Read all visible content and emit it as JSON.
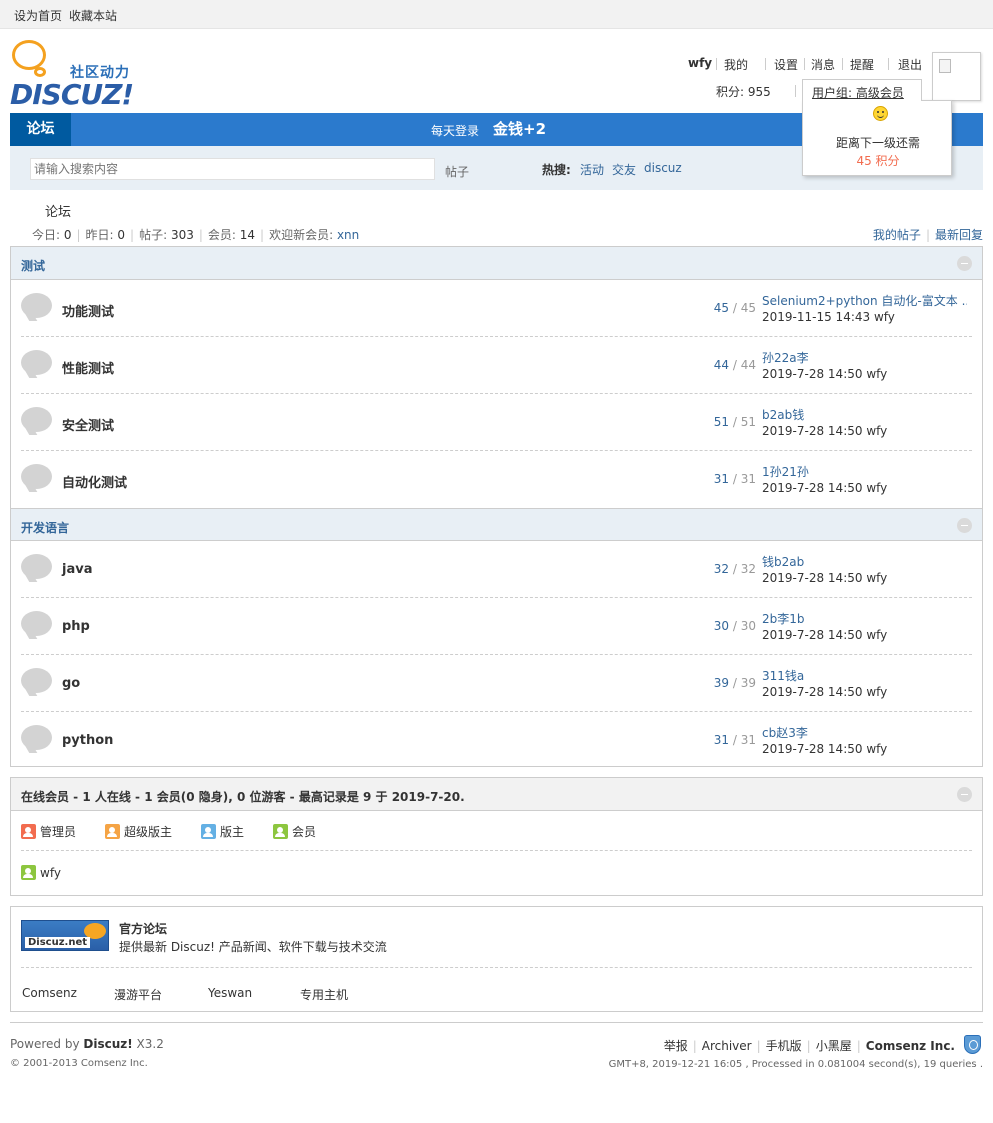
{
  "topbar": {
    "set_home": "设为首页",
    "bookmark": "收藏本站"
  },
  "logo": {
    "sub": "社区动力",
    "main": "DISCUZ!"
  },
  "user_menu": {
    "username": "wfy",
    "mine": "我的",
    "settings": "设置",
    "messages": "消息",
    "reminders": "提醒",
    "logout": "退出",
    "credits": "积分: 955",
    "usergroup": "用户组: 高级会员"
  },
  "popup": {
    "line1": "距离下一级还需",
    "line2": "45 积分"
  },
  "nav": {
    "forum": "论坛",
    "daily_login": "每天登录",
    "money": "金钱+2"
  },
  "search": {
    "placeholder": "请输入搜索内容",
    "type": "帖子",
    "hot_label": "热搜:",
    "hot_terms": [
      "活动",
      "交友",
      "discuz"
    ]
  },
  "breadcrumb": "论坛",
  "stats": {
    "today_label": "今日: ",
    "today": "0",
    "yesterday_label": "昨日: ",
    "yesterday": "0",
    "posts_label": "帖子: ",
    "posts": "303",
    "members_label": "会员: ",
    "members": "14",
    "welcome_label": "欢迎新会员: ",
    "new_member": "xnn"
  },
  "my_links": {
    "my_posts": "我的帖子",
    "latest": "最新回复"
  },
  "categories": [
    {
      "title": "测试",
      "forums": [
        {
          "name": "功能测试",
          "threads": "45",
          "posts": "45",
          "last_title": "Selenium2+python 自动化-富文本 ...",
          "last_meta": "2019-11-15 14:43 wfy"
        },
        {
          "name": "性能测试",
          "threads": "44",
          "posts": "44",
          "last_title": "孙22a李",
          "last_meta": "2019-7-28 14:50 wfy"
        },
        {
          "name": "安全测试",
          "threads": "51",
          "posts": "51",
          "last_title": "b2ab钱",
          "last_meta": "2019-7-28 14:50 wfy"
        },
        {
          "name": "自动化测试",
          "threads": "31",
          "posts": "31",
          "last_title": "1孙21孙",
          "last_meta": "2019-7-28 14:50 wfy"
        }
      ]
    },
    {
      "title": "开发语言",
      "forums": [
        {
          "name": "java",
          "threads": "32",
          "posts": "32",
          "last_title": "钱b2ab",
          "last_meta": "2019-7-28 14:50 wfy"
        },
        {
          "name": "php",
          "threads": "30",
          "posts": "30",
          "last_title": "2b李1b",
          "last_meta": "2019-7-28 14:50 wfy"
        },
        {
          "name": "go",
          "threads": "39",
          "posts": "39",
          "last_title": "311钱a",
          "last_meta": "2019-7-28 14:50 wfy"
        },
        {
          "name": "python",
          "threads": "31",
          "posts": "31",
          "last_title": "cb赵3李",
          "last_meta": "2019-7-28 14:50 wfy"
        }
      ]
    }
  ],
  "online": {
    "title": "在线会员 - 1 人在线 - 1 会员(0 隐身), 0 位游客 - 最高记录是 9 于 2019-7-20.",
    "legend": [
      "管理员",
      "超级版主",
      "版主",
      "会员"
    ],
    "users": [
      "wfy"
    ],
    "colors": {
      "admin": "#f26c4f",
      "super_mod": "#f5a445",
      "mod": "#64b0e4",
      "member": "#8dc63f"
    }
  },
  "links": {
    "logo_text": "Discuz.net",
    "title": "官方论坛",
    "desc": "提供最新 Discuz! 产品新闻、软件下载与技术交流",
    "items": [
      "Comsenz",
      "漫游平台",
      "Yeswan",
      "专用主机"
    ]
  },
  "footer": {
    "powered_by": "Powered by ",
    "product": "Discuz!",
    "version": " X3.2",
    "copyright": "© 2001-2013 Comsenz Inc.",
    "links": [
      "举报",
      "Archiver",
      "手机版",
      "小黑屋"
    ],
    "company": "Comsenz Inc.",
    "gmt": "GMT+8, 2019-12-21 16:05 , Processed in 0.081004 second(s), 19 queries ."
  }
}
